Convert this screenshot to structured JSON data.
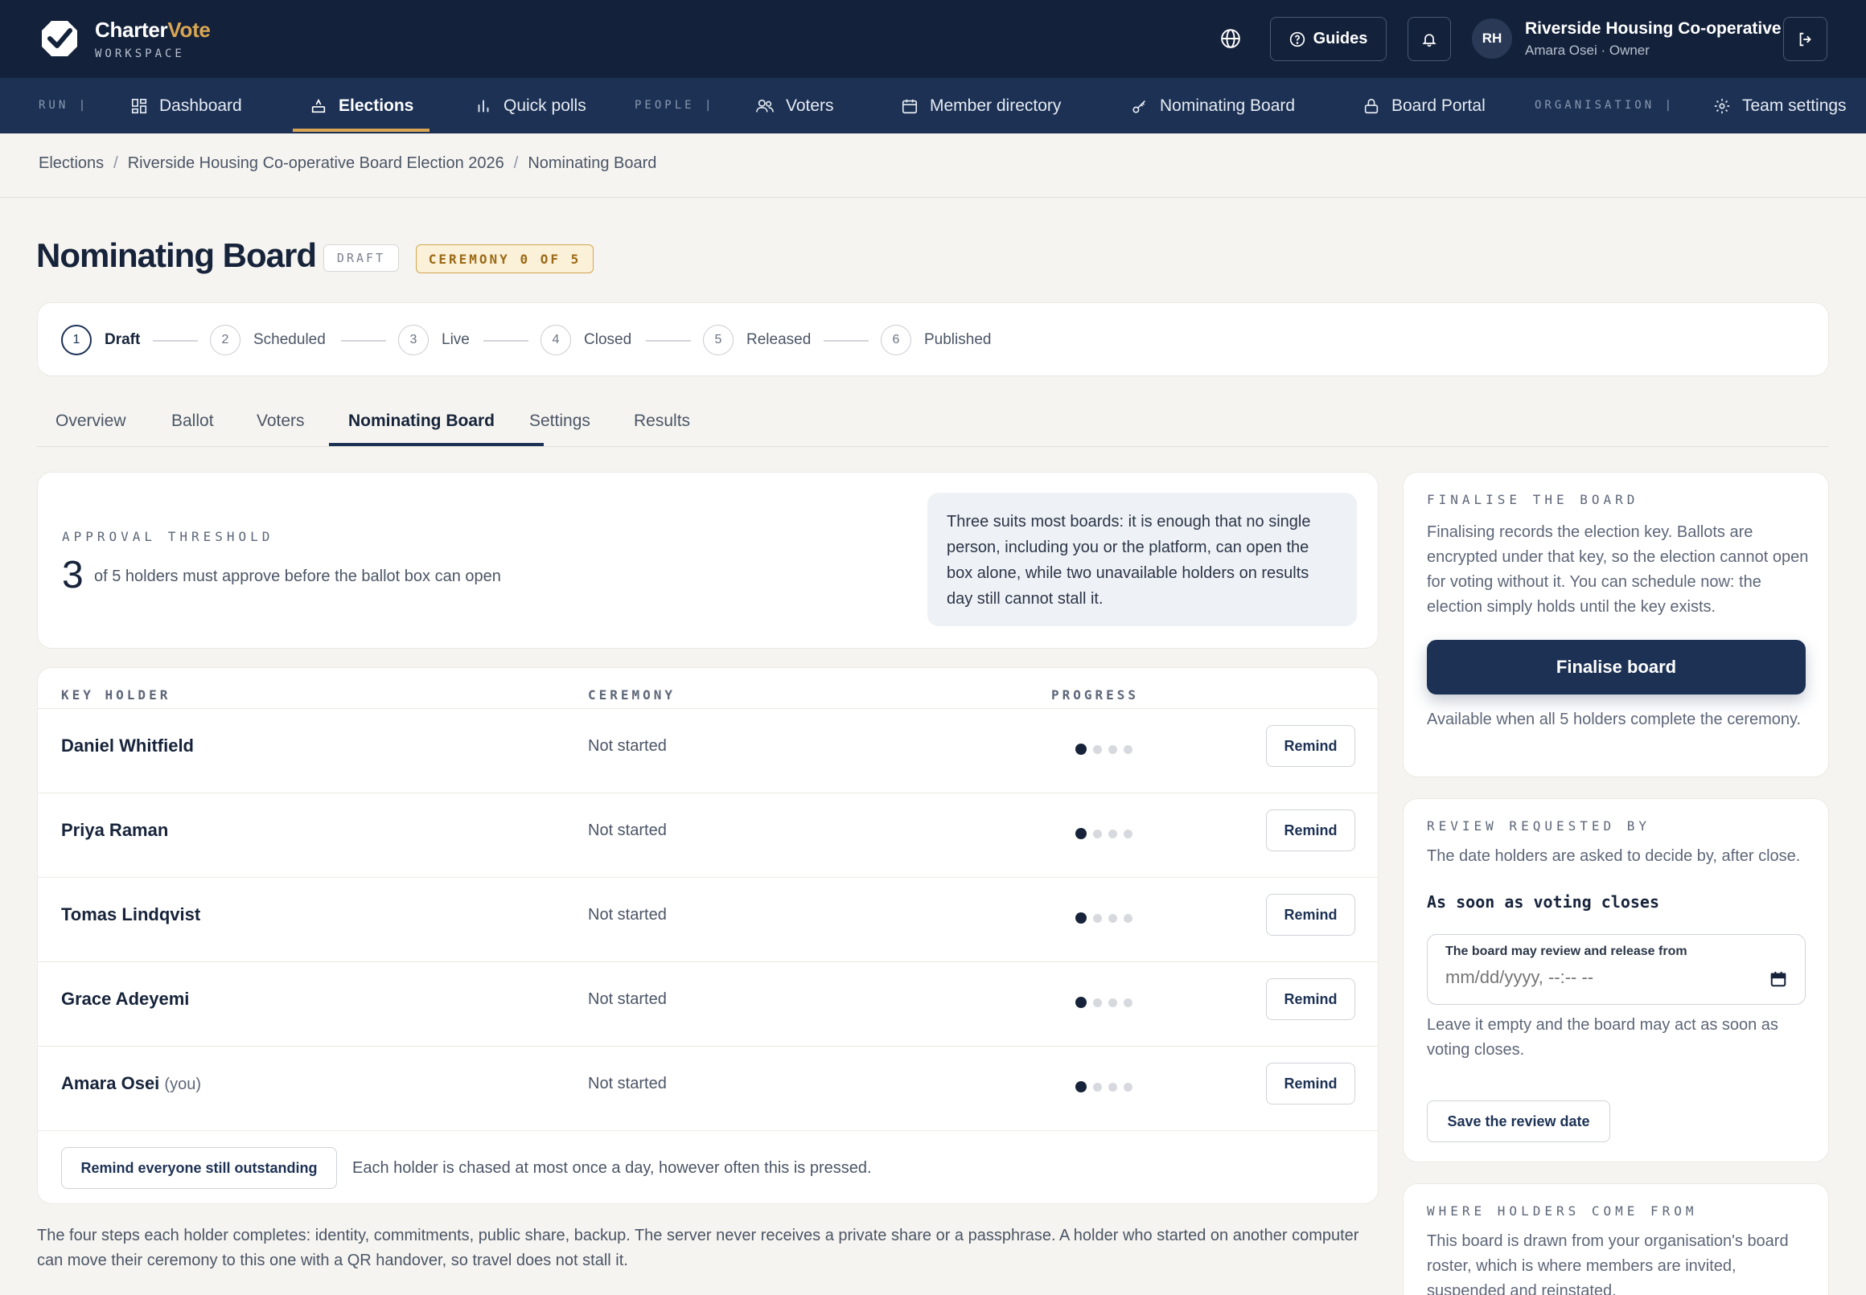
{
  "brand": {
    "name_part1": "Charter",
    "name_part2": "Vote",
    "subtitle": "WORKSPACE"
  },
  "topbar": {
    "guides_label": "Guides",
    "avatar_initials": "RH",
    "org_name": "Riverside Housing Co-operative",
    "user_line": "Amara Osei · Owner"
  },
  "nav": {
    "sections": [
      "RUN",
      "PEOPLE",
      "ORGANISATION"
    ],
    "items": [
      {
        "label": "Dashboard",
        "icon": "dashboard-icon"
      },
      {
        "label": "Elections",
        "icon": "ballot-box-icon",
        "active": true
      },
      {
        "label": "Quick polls",
        "icon": "bar-chart-icon"
      },
      {
        "label": "Voters",
        "icon": "users-icon"
      },
      {
        "label": "Member directory",
        "icon": "calendar-icon"
      },
      {
        "label": "Nominating Board",
        "icon": "key-icon"
      },
      {
        "label": "Board Portal",
        "icon": "lock-icon"
      },
      {
        "label": "Team settings",
        "icon": "gear-icon"
      }
    ]
  },
  "breadcrumb": [
    "Elections",
    "Riverside Housing Co-operative Board Election 2026",
    "Nominating Board"
  ],
  "page": {
    "title": "Nominating Board",
    "status_badge": "DRAFT",
    "ceremony_badge": "CEREMONY 0 OF 5"
  },
  "stepper": [
    {
      "num": "1",
      "label": "Draft",
      "active": true
    },
    {
      "num": "2",
      "label": "Scheduled"
    },
    {
      "num": "3",
      "label": "Live"
    },
    {
      "num": "4",
      "label": "Closed"
    },
    {
      "num": "5",
      "label": "Released"
    },
    {
      "num": "6",
      "label": "Published"
    }
  ],
  "tabs": [
    "Overview",
    "Ballot",
    "Voters",
    "Nominating Board",
    "Settings",
    "Results"
  ],
  "active_tab": "Nominating Board",
  "threshold": {
    "eyebrow": "APPROVAL THRESHOLD",
    "value": "3",
    "text": "of 5 holders must approve before the ballot box can open",
    "note": "Three suits most boards: it is enough that no single person, including you or the platform, can open the box alone, while two unavailable holders on results day still cannot stall it."
  },
  "table": {
    "headers": {
      "holder": "KEY HOLDER",
      "ceremony": "CEREMONY",
      "progress": "PROGRESS"
    },
    "remind_label": "Remind",
    "progress_steps_total": 4,
    "rows": [
      {
        "name": "Daniel Whitfield",
        "suffix": "",
        "status": "Not started",
        "progress_step": 1
      },
      {
        "name": "Priya Raman",
        "suffix": "",
        "status": "Not started",
        "progress_step": 1
      },
      {
        "name": "Tomas Lindqvist",
        "suffix": "",
        "status": "Not started",
        "progress_step": 1
      },
      {
        "name": "Grace Adeyemi",
        "suffix": "",
        "status": "Not started",
        "progress_step": 1
      },
      {
        "name": "Amara Osei",
        "suffix": "(you)",
        "status": "Not started",
        "progress_step": 1
      }
    ],
    "remind_all_label": "Remind everyone still outstanding",
    "footer_note": "Each holder is chased at most once a day, however often this is pressed."
  },
  "bottom_note": "The four steps each holder completes: identity, commitments, public share, backup. The server never receives a private share or a passphrase. A holder who started on another computer can move their ceremony to this one with a QR handover, so travel does not stall it.",
  "finalise": {
    "eyebrow": "FINALISE THE BOARD",
    "text": "Finalising records the election key. Ballots are encrypted under that key, so the election cannot open for voting without it. You can schedule now: the election simply holds until the key exists.",
    "button": "Finalise board",
    "note": "Available when all 5 holders complete the ceremony."
  },
  "review": {
    "eyebrow": "REVIEW REQUESTED BY",
    "text": "The date holders are asked to decide by, after close.",
    "value": "As soon as voting closes",
    "field_label": "The board may review and release from",
    "field_placeholder": "mm/dd/yyyy, --:-- --",
    "help": "Leave it empty and the board may act as soon as voting closes.",
    "save_button": "Save the review date"
  },
  "where": {
    "eyebrow": "WHERE HOLDERS COME FROM",
    "text": "This board is drawn from your organisation's board roster, which is where members are invited, suspended and reinstated."
  },
  "colors": {
    "topbar": "#13213a",
    "navbar": "#1c3154",
    "accent": "#d9a653",
    "background": "#f5f4f0"
  }
}
